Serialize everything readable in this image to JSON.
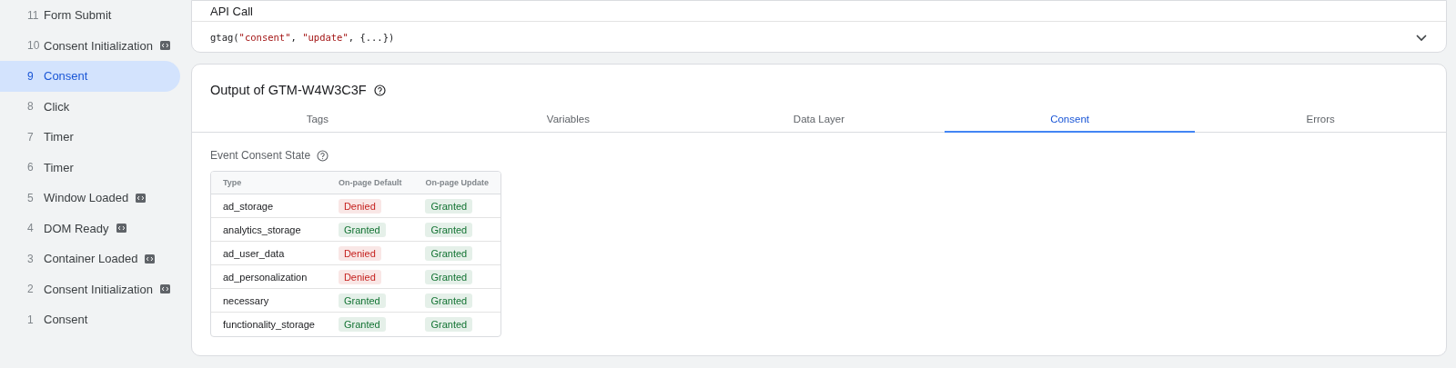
{
  "sidebar": {
    "items": [
      {
        "number": "11",
        "label": "Form Submit",
        "code_icon": false,
        "selected": false
      },
      {
        "number": "10",
        "label": "Consent Initialization",
        "code_icon": true,
        "selected": false
      },
      {
        "number": "9",
        "label": "Consent",
        "code_icon": false,
        "selected": true
      },
      {
        "number": "8",
        "label": "Click",
        "code_icon": false,
        "selected": false
      },
      {
        "number": "7",
        "label": "Timer",
        "code_icon": false,
        "selected": false
      },
      {
        "number": "6",
        "label": "Timer",
        "code_icon": false,
        "selected": false
      },
      {
        "number": "5",
        "label": "Window Loaded",
        "code_icon": true,
        "selected": false
      },
      {
        "number": "4",
        "label": "DOM Ready",
        "code_icon": true,
        "selected": false
      },
      {
        "number": "3",
        "label": "Container Loaded",
        "code_icon": true,
        "selected": false
      },
      {
        "number": "2",
        "label": "Consent Initialization",
        "code_icon": true,
        "selected": false
      },
      {
        "number": "1",
        "label": "Consent",
        "code_icon": false,
        "selected": false
      }
    ]
  },
  "api_call": {
    "title": "API Call",
    "code": [
      {
        "text": "gtag(",
        "kind": "plain"
      },
      {
        "text": "\"consent\"",
        "kind": "string"
      },
      {
        "text": ", ",
        "kind": "plain"
      },
      {
        "text": "\"update\"",
        "kind": "string"
      },
      {
        "text": ", {...})",
        "kind": "plain"
      }
    ],
    "expanded": false
  },
  "output": {
    "title": "Output of GTM-W4W3C3F",
    "tabs": [
      {
        "label": "Tags",
        "selected": false
      },
      {
        "label": "Variables",
        "selected": false
      },
      {
        "label": "Data Layer",
        "selected": false
      },
      {
        "label": "Consent",
        "selected": true
      },
      {
        "label": "Errors",
        "selected": false
      }
    ],
    "section_title": "Event Consent State",
    "table": {
      "columns": [
        "Type",
        "On-page Default",
        "On-page Update"
      ],
      "rows": [
        {
          "type": "ad_storage",
          "default": {
            "text": "Denied",
            "color": "#c5221f"
          },
          "update": {
            "text": "Granted",
            "color": "#137333"
          }
        },
        {
          "type": "analytics_storage",
          "default": {
            "text": "Granted",
            "color": "#137333"
          },
          "update": {
            "text": "Granted",
            "color": "#137333"
          }
        },
        {
          "type": "ad_user_data",
          "default": {
            "text": "Denied",
            "color": "#c5221f"
          },
          "update": {
            "text": "Granted",
            "color": "#137333"
          }
        },
        {
          "type": "ad_personalization",
          "default": {
            "text": "Denied",
            "color": "#c5221f"
          },
          "update": {
            "text": "Granted",
            "color": "#137333"
          }
        },
        {
          "type": "necessary",
          "default": {
            "text": "Granted",
            "color": "#137333"
          },
          "update": {
            "text": "Granted",
            "color": "#137333"
          }
        },
        {
          "type": "functionality_storage",
          "default": {
            "text": "Granted",
            "color": "#137333"
          },
          "update": {
            "text": "Granted",
            "color": "#137333"
          }
        }
      ]
    }
  }
}
